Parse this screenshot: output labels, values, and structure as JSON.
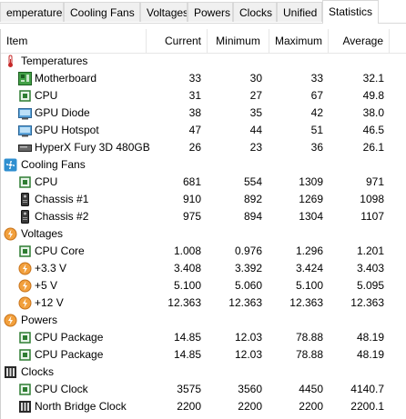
{
  "tabs": [
    {
      "label": "emperatures",
      "active": false
    },
    {
      "label": "Cooling Fans",
      "active": false
    },
    {
      "label": "Voltages",
      "active": false
    },
    {
      "label": "Powers",
      "active": false
    },
    {
      "label": "Clocks",
      "active": false
    },
    {
      "label": "Unified",
      "active": false
    },
    {
      "label": "Statistics",
      "active": true
    }
  ],
  "columns": {
    "item": "Item",
    "current": "Current",
    "minimum": "Minimum",
    "maximum": "Maximum",
    "average": "Average"
  },
  "rows": [
    {
      "kind": "group",
      "label": "Temperatures",
      "icon": "thermometer-icon"
    },
    {
      "kind": "item",
      "label": "Motherboard",
      "icon": "motherboard-icon",
      "current": "33",
      "minimum": "30",
      "maximum": "33",
      "average": "32.1"
    },
    {
      "kind": "item",
      "label": "CPU",
      "icon": "cpu-icon",
      "current": "31",
      "minimum": "27",
      "maximum": "67",
      "average": "49.8"
    },
    {
      "kind": "item",
      "label": "GPU Diode",
      "icon": "gpu-icon",
      "current": "38",
      "minimum": "35",
      "maximum": "42",
      "average": "38.0"
    },
    {
      "kind": "item",
      "label": "GPU Hotspot",
      "icon": "gpu-icon",
      "current": "47",
      "minimum": "44",
      "maximum": "51",
      "average": "46.5"
    },
    {
      "kind": "item",
      "label": "HyperX Fury 3D 480GB",
      "icon": "drive-icon",
      "current": "26",
      "minimum": "23",
      "maximum": "36",
      "average": "26.1"
    },
    {
      "kind": "group",
      "label": "Cooling Fans",
      "icon": "fan-icon"
    },
    {
      "kind": "item",
      "label": "CPU",
      "icon": "cpu-icon",
      "current": "681",
      "minimum": "554",
      "maximum": "1309",
      "average": "971"
    },
    {
      "kind": "item",
      "label": "Chassis #1",
      "icon": "chassis-icon",
      "current": "910",
      "minimum": "892",
      "maximum": "1269",
      "average": "1098"
    },
    {
      "kind": "item",
      "label": "Chassis #2",
      "icon": "chassis-icon",
      "current": "975",
      "minimum": "894",
      "maximum": "1304",
      "average": "1107"
    },
    {
      "kind": "group",
      "label": "Voltages",
      "icon": "voltage-icon"
    },
    {
      "kind": "item",
      "label": "CPU Core",
      "icon": "cpu-icon",
      "current": "1.008",
      "minimum": "0.976",
      "maximum": "1.296",
      "average": "1.201"
    },
    {
      "kind": "item",
      "label": "+3.3 V",
      "icon": "voltage-icon",
      "current": "3.408",
      "minimum": "3.392",
      "maximum": "3.424",
      "average": "3.403"
    },
    {
      "kind": "item",
      "label": "+5 V",
      "icon": "voltage-icon",
      "current": "5.100",
      "minimum": "5.060",
      "maximum": "5.100",
      "average": "5.095"
    },
    {
      "kind": "item",
      "label": "+12 V",
      "icon": "voltage-icon",
      "current": "12.363",
      "minimum": "12.363",
      "maximum": "12.363",
      "average": "12.363"
    },
    {
      "kind": "group",
      "label": "Powers",
      "icon": "power-icon"
    },
    {
      "kind": "item",
      "label": "CPU Package",
      "icon": "cpu-icon",
      "current": "14.85",
      "minimum": "12.03",
      "maximum": "78.88",
      "average": "48.19"
    },
    {
      "kind": "item",
      "label": "CPU Package",
      "icon": "cpu-icon",
      "current": "14.85",
      "minimum": "12.03",
      "maximum": "78.88",
      "average": "48.19"
    },
    {
      "kind": "group",
      "label": "Clocks",
      "icon": "clock-icon"
    },
    {
      "kind": "item",
      "label": "CPU Clock",
      "icon": "cpu-icon",
      "current": "3575",
      "minimum": "3560",
      "maximum": "4450",
      "average": "4140.7"
    },
    {
      "kind": "item",
      "label": "North Bridge Clock",
      "icon": "chip-icon",
      "current": "2200",
      "minimum": "2200",
      "maximum": "2200",
      "average": "2200.1"
    }
  ]
}
